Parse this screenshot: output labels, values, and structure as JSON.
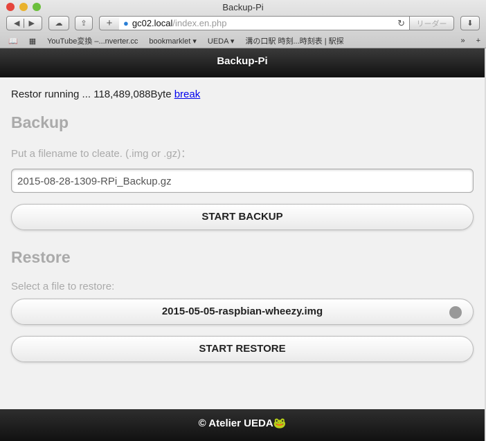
{
  "window": {
    "title": "Backup-Pi",
    "url_host": "gc02.local",
    "url_path": "/index.en.php",
    "reader": "リーダー"
  },
  "bookmarks": [
    "YouTube変換 –...nverter.cc",
    "bookmarklet ▾",
    "UEDA ▾",
    "溝の口駅 時刻...時刻表 | 駅探"
  ],
  "header": {
    "title": "Backup-Pi"
  },
  "status": {
    "text": "Restor running ... 118,489,088Byte ",
    "link": "break"
  },
  "backup": {
    "heading": "Backup",
    "label": "Put a filename to cleate. (.img or .gz)：",
    "filename": "2015-08-28-1309-RPi_Backup.gz",
    "button": "START BACKUP"
  },
  "restore": {
    "heading": "Restore",
    "label": "Select a file to restore:",
    "selected": "2015-05-05-raspbian-wheezy.img",
    "button": "START RESTORE"
  },
  "footer": {
    "text": "© Atelier UEDA"
  }
}
